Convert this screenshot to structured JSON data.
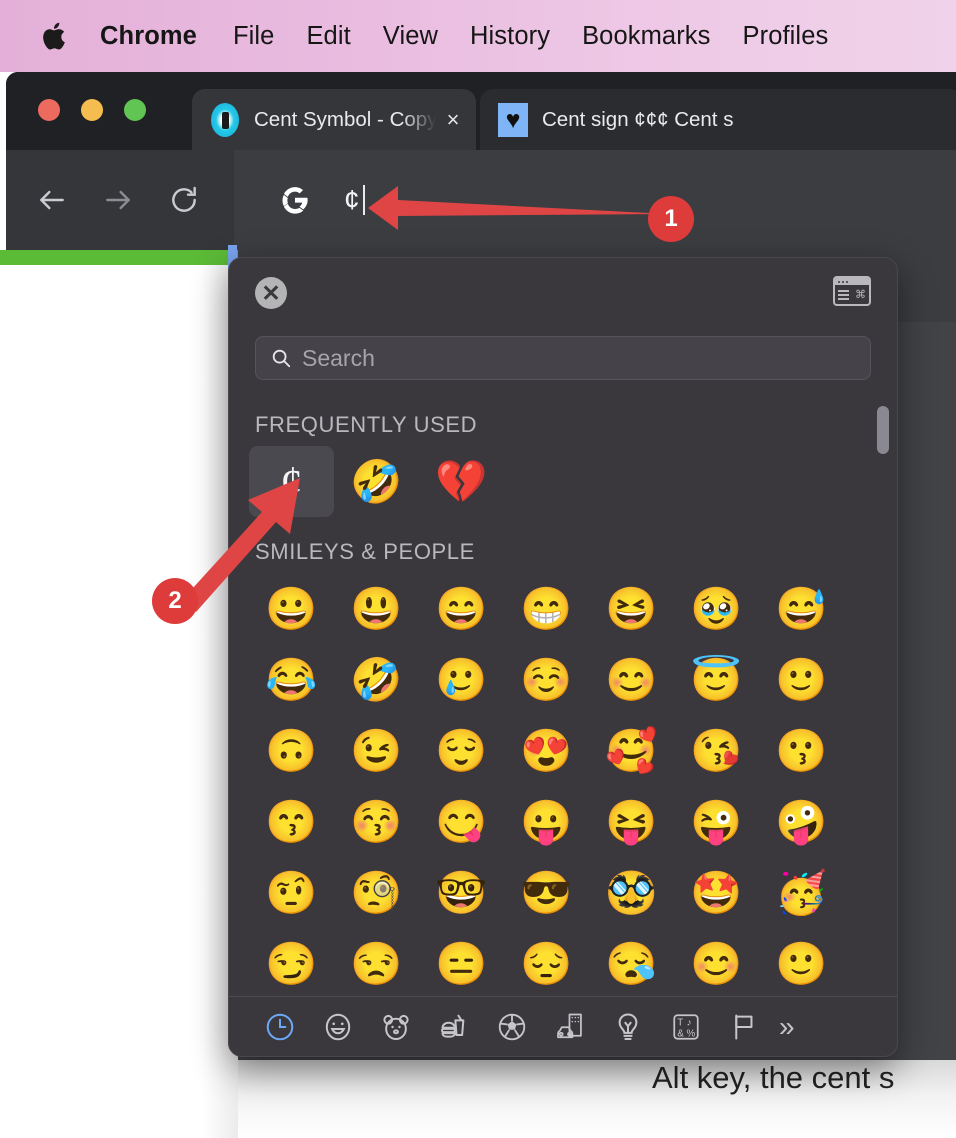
{
  "menubar": {
    "apple_icon": "apple-logo-icon",
    "items": [
      {
        "label": "Chrome",
        "bold": true
      },
      {
        "label": "File",
        "bold": false
      },
      {
        "label": "Edit",
        "bold": false
      },
      {
        "label": "View",
        "bold": false
      },
      {
        "label": "History",
        "bold": false
      },
      {
        "label": "Bookmarks",
        "bold": false
      },
      {
        "label": "Profiles",
        "bold": false
      }
    ],
    "bg_left": "#e4b0d9",
    "bg_right": "#f0d2ea"
  },
  "browser": {
    "traffic_lights": {
      "close": "#ed6a5f",
      "minimize": "#f5bd4f",
      "maximize": "#61c554"
    },
    "tabs": [
      {
        "title": "Cent Symbol - Copy and Past",
        "favicon": "cent-page-favicon",
        "active": true,
        "close_label": "×"
      },
      {
        "title": "Cent sign ¢¢¢ Cent s",
        "favicon": "heart-favicon",
        "active": false,
        "close_label": ""
      }
    ],
    "toolbar": {
      "back_icon": "back-arrow-icon",
      "forward_icon": "forward-arrow-icon",
      "reload_icon": "reload-icon",
      "search_engine_icon": "google-g-icon",
      "omnibox_value": "¢",
      "bar_color": "#35363a"
    },
    "loading_bar_color": "#5bba36"
  },
  "emoji_picker": {
    "close_label": "✕",
    "close_icon": "close-circle-icon",
    "character_viewer_icon": "character-viewer-icon",
    "search": {
      "placeholder": "Search",
      "value": "",
      "icon": "search-icon"
    },
    "sections": [
      {
        "title": "FREQUENTLY USED",
        "rows": [
          [
            {
              "glyph": "¢",
              "name": "cent-symbol",
              "selected": true,
              "is_text": true
            },
            {
              "glyph": "🤣",
              "name": "rolling-on-the-floor-laughing-emoji",
              "selected": false
            },
            {
              "glyph": "💔",
              "name": "broken-heart-emoji",
              "selected": false
            }
          ]
        ]
      },
      {
        "title": "SMILEYS & PEOPLE",
        "rows": [
          [
            {
              "glyph": "😀",
              "name": "grinning-face-emoji"
            },
            {
              "glyph": "😃",
              "name": "grinning-face-big-eyes-emoji"
            },
            {
              "glyph": "😄",
              "name": "grinning-face-smiling-eyes-emoji"
            },
            {
              "glyph": "😁",
              "name": "beaming-face-emoji"
            },
            {
              "glyph": "😆",
              "name": "grinning-squinting-face-emoji"
            },
            {
              "glyph": "🥹",
              "name": "face-holding-back-tears-emoji"
            },
            {
              "glyph": "😅",
              "name": "grinning-face-sweat-emoji"
            }
          ],
          [
            {
              "glyph": "😂",
              "name": "face-with-tears-of-joy-emoji"
            },
            {
              "glyph": "🤣",
              "name": "rolling-on-the-floor-laughing-emoji"
            },
            {
              "glyph": "🥲",
              "name": "smiling-face-with-tear-emoji"
            },
            {
              "glyph": "☺️",
              "name": "smiling-face-emoji"
            },
            {
              "glyph": "😊",
              "name": "smiling-face-smiling-eyes-emoji"
            },
            {
              "glyph": "😇",
              "name": "smiling-face-with-halo-emoji"
            },
            {
              "glyph": "🙂",
              "name": "slightly-smiling-face-emoji"
            }
          ],
          [
            {
              "glyph": "🙃",
              "name": "upside-down-face-emoji"
            },
            {
              "glyph": "😉",
              "name": "winking-face-emoji"
            },
            {
              "glyph": "😌",
              "name": "relieved-face-emoji"
            },
            {
              "glyph": "😍",
              "name": "smiling-face-heart-eyes-emoji"
            },
            {
              "glyph": "🥰",
              "name": "smiling-face-with-hearts-emoji"
            },
            {
              "glyph": "😘",
              "name": "face-blowing-a-kiss-emoji"
            },
            {
              "glyph": "😗",
              "name": "kissing-face-emoji"
            }
          ],
          [
            {
              "glyph": "😙",
              "name": "kissing-face-smiling-eyes-emoji"
            },
            {
              "glyph": "😚",
              "name": "kissing-face-closed-eyes-emoji"
            },
            {
              "glyph": "😋",
              "name": "face-savoring-food-emoji"
            },
            {
              "glyph": "😛",
              "name": "face-with-tongue-emoji"
            },
            {
              "glyph": "😝",
              "name": "squinting-face-with-tongue-emoji"
            },
            {
              "glyph": "😜",
              "name": "winking-face-with-tongue-emoji"
            },
            {
              "glyph": "🤪",
              "name": "zany-face-emoji"
            }
          ],
          [
            {
              "glyph": "🤨",
              "name": "face-with-raised-eyebrow-emoji"
            },
            {
              "glyph": "🧐",
              "name": "face-with-monocle-emoji"
            },
            {
              "glyph": "🤓",
              "name": "nerd-face-emoji"
            },
            {
              "glyph": "😎",
              "name": "smiling-face-sunglasses-emoji"
            },
            {
              "glyph": "🥸",
              "name": "disguised-face-emoji"
            },
            {
              "glyph": "🤩",
              "name": "star-struck-emoji"
            },
            {
              "glyph": "🥳",
              "name": "partying-face-emoji"
            }
          ],
          [
            {
              "glyph": "😏",
              "name": "smirking-face-emoji"
            },
            {
              "glyph": "😒",
              "name": "unamused-face-emoji"
            },
            {
              "glyph": "😑",
              "name": "expressionless-face-emoji"
            },
            {
              "glyph": "😔",
              "name": "pensive-face-emoji"
            },
            {
              "glyph": "😪",
              "name": "sleepy-face-emoji"
            },
            {
              "glyph": "😊",
              "name": "smiling-face-emoji"
            },
            {
              "glyph": "🙂",
              "name": "slightly-smiling-face-emoji"
            }
          ]
        ]
      }
    ],
    "categories": [
      {
        "name": "category-frequently-used",
        "icon": "clock-icon",
        "active": true
      },
      {
        "name": "category-smileys-people",
        "icon": "smiley-icon",
        "active": false
      },
      {
        "name": "category-animals-nature",
        "icon": "bear-icon",
        "active": false
      },
      {
        "name": "category-food-drink",
        "icon": "food-drink-icon",
        "active": false
      },
      {
        "name": "category-activity",
        "icon": "soccer-ball-icon",
        "active": false
      },
      {
        "name": "category-travel-places",
        "icon": "car-building-icon",
        "active": false
      },
      {
        "name": "category-objects",
        "icon": "lightbulb-icon",
        "active": false
      },
      {
        "name": "category-symbols",
        "icon": "symbols-icon",
        "active": false
      },
      {
        "name": "category-flags",
        "icon": "flag-icon",
        "active": false
      }
    ],
    "more_label": "»",
    "accent_color": "#6ba8f5"
  },
  "annotations": [
    {
      "number": "1",
      "name": "annotation-marker-1",
      "target": "omnibox-cent-character"
    },
    {
      "number": "2",
      "name": "annotation-marker-2",
      "target": "frequently-used-cent-symbol"
    }
  ],
  "page_content": {
    "bottom_text": "Alt key, the cent s"
  }
}
